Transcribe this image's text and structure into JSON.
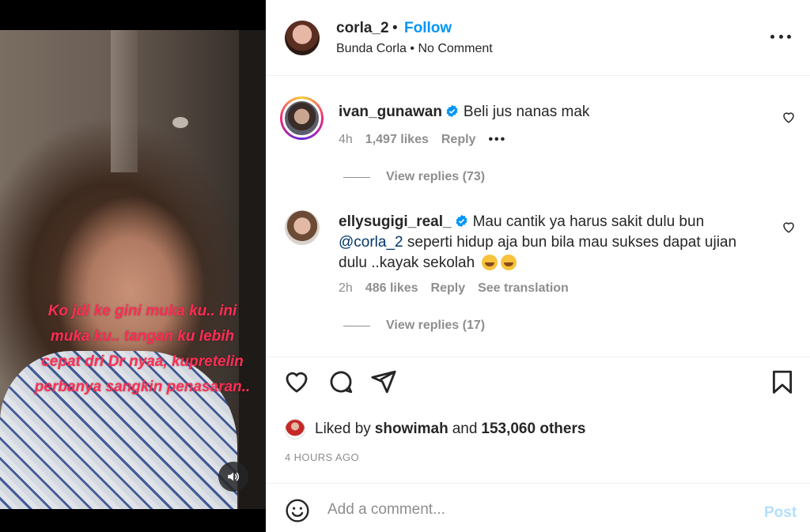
{
  "media": {
    "caption": "Ko jdi ke gini muka ku.. ini muka ku.. tangan ku lebih cepat dri Dr nyaa, kupretelin perbanya sangkin penasaran..",
    "sound_icon": "speaker-icon"
  },
  "header": {
    "username": "corla_2",
    "separator": "•",
    "follow_label": "Follow",
    "subtitle": "Bunda Corla • No Comment",
    "more_icon": "more-horizontal-icon"
  },
  "comments": [
    {
      "username": "ivan_gunawan",
      "verified": true,
      "text": "Beli jus nanas mak",
      "time": "4h",
      "likes": "1,497 likes",
      "reply_label": "Reply",
      "more": "•••",
      "view_replies": "View replies (73)"
    },
    {
      "username": "ellysugigi_real_",
      "verified": true,
      "text": "Mau cantik ya harus sakit dulu bun",
      "mention": "@corla_2",
      "text2": "seperti hidup aja bun bila mau sukses dapat ujian dulu ..kayak sekolah",
      "time": "2h",
      "likes": "486 likes",
      "reply_label": "Reply",
      "translation_label": "See translation",
      "view_replies": "View replies (17)"
    }
  ],
  "actions": {
    "icons": [
      "heart-icon",
      "comment-icon",
      "share-icon",
      "bookmark-icon"
    ]
  },
  "likes": {
    "prefix": "Liked by",
    "user": "showimah",
    "and": "and",
    "others": "153,060 others"
  },
  "timestamp": "4 HOURS AGO",
  "add_comment": {
    "placeholder": "Add a comment...",
    "post_label": "Post"
  },
  "colors": {
    "accent": "#0095f6",
    "caption": "#ff2d55",
    "post_disabled": "#b2dffc",
    "muted": "#8e8e8e"
  }
}
